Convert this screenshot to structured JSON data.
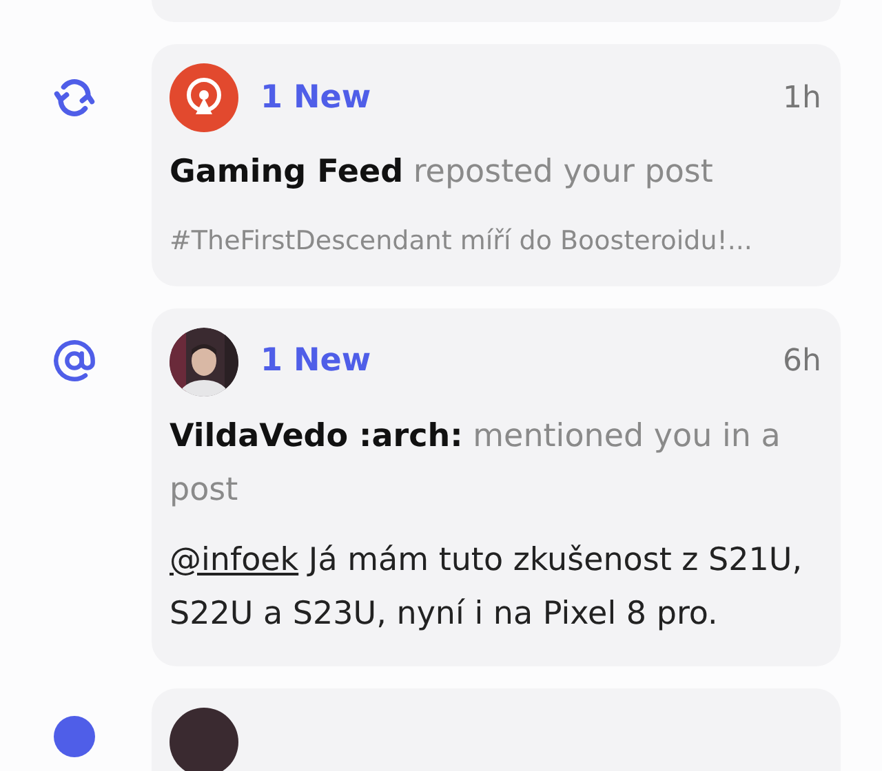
{
  "notifications": [
    {
      "kind": "repost",
      "avatar": {
        "kind": "logo"
      },
      "badge": "1 New",
      "time": "1h",
      "actor": "Gaming Feed",
      "action": "reposted your post",
      "excerpt": "#TheFirstDescendant míří do Boosteroidu!..."
    },
    {
      "kind": "mention",
      "badge": "1 New",
      "time": "6h",
      "actor": "VildaVedo :arch:",
      "action": "mentioned you in a post",
      "mention": "@infoek",
      "body": "Já mám tuto zkušenost z S21U, S22U a S23U, nyní i na Pixel 8 pro."
    }
  ]
}
